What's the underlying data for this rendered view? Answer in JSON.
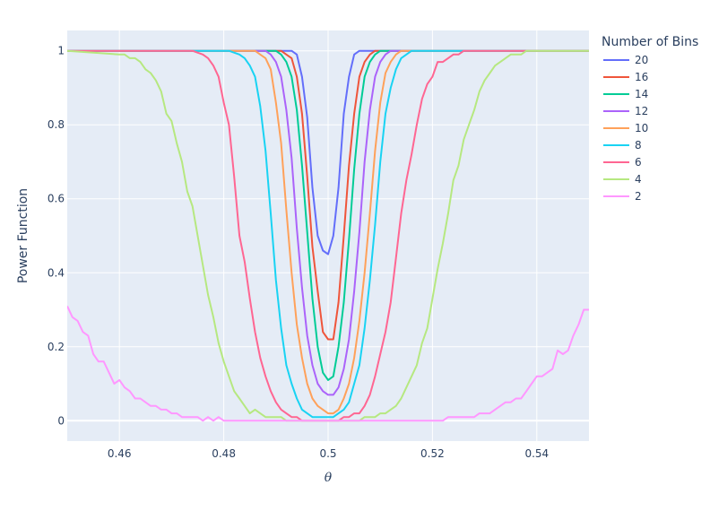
{
  "chart_data": {
    "type": "line",
    "xlabel": "θ",
    "ylabel": "Power Function",
    "xlim": [
      0.45,
      0.55
    ],
    "ylim": [
      -0.055,
      1.055
    ],
    "x_ticks": [
      0.46,
      0.48,
      0.5,
      0.52,
      0.54
    ],
    "x_tick_labels": [
      "0.46",
      "0.48",
      "0.5",
      "0.52",
      "0.54"
    ],
    "y_ticks": [
      0,
      0.2,
      0.4,
      0.6,
      0.8,
      1
    ],
    "y_tick_labels": [
      "0",
      "0.2",
      "0.4",
      "0.6",
      "0.8",
      "1"
    ],
    "grid": true,
    "legend_title": "Number of Bins",
    "legend_position": "right",
    "series": [
      {
        "name": "20",
        "color": "#636efa",
        "x": [
          0.45,
          0.49,
          0.493,
          0.494,
          0.495,
          0.496,
          0.497,
          0.498,
          0.499,
          0.5,
          0.501,
          0.502,
          0.503,
          0.504,
          0.505,
          0.506,
          0.507,
          0.55
        ],
        "y": [
          1,
          1,
          1,
          0.99,
          0.93,
          0.82,
          0.63,
          0.5,
          0.46,
          0.45,
          0.5,
          0.63,
          0.83,
          0.93,
          0.99,
          1,
          1,
          1
        ]
      },
      {
        "name": "16",
        "color": "#EF553B",
        "x": [
          0.45,
          0.489,
          0.491,
          0.492,
          0.493,
          0.494,
          0.495,
          0.496,
          0.497,
          0.498,
          0.499,
          0.5,
          0.501,
          0.502,
          0.503,
          0.504,
          0.505,
          0.506,
          0.507,
          0.508,
          0.509,
          0.511,
          0.55
        ],
        "y": [
          1,
          1,
          1,
          0.99,
          0.98,
          0.93,
          0.83,
          0.66,
          0.47,
          0.35,
          0.24,
          0.22,
          0.22,
          0.32,
          0.5,
          0.69,
          0.83,
          0.93,
          0.97,
          0.99,
          1,
          1,
          1
        ]
      },
      {
        "name": "14",
        "color": "#00cc96",
        "x": [
          0.45,
          0.488,
          0.49,
          0.491,
          0.492,
          0.493,
          0.494,
          0.495,
          0.496,
          0.497,
          0.498,
          0.499,
          0.5,
          0.501,
          0.502,
          0.503,
          0.504,
          0.505,
          0.506,
          0.507,
          0.508,
          0.509,
          0.51,
          0.512,
          0.55
        ],
        "y": [
          1,
          1,
          1,
          0.99,
          0.97,
          0.93,
          0.84,
          0.69,
          0.51,
          0.33,
          0.2,
          0.13,
          0.11,
          0.12,
          0.2,
          0.32,
          0.49,
          0.68,
          0.83,
          0.93,
          0.97,
          0.99,
          1,
          1,
          1
        ]
      },
      {
        "name": "12",
        "color": "#ab63fa",
        "x": [
          0.45,
          0.486,
          0.488,
          0.489,
          0.49,
          0.491,
          0.492,
          0.493,
          0.494,
          0.495,
          0.496,
          0.497,
          0.498,
          0.499,
          0.5,
          0.501,
          0.502,
          0.503,
          0.504,
          0.505,
          0.506,
          0.507,
          0.508,
          0.509,
          0.51,
          0.511,
          0.512,
          0.514,
          0.55
        ],
        "y": [
          1,
          1,
          1,
          0.99,
          0.97,
          0.93,
          0.84,
          0.71,
          0.52,
          0.36,
          0.23,
          0.15,
          0.1,
          0.08,
          0.07,
          0.07,
          0.09,
          0.14,
          0.22,
          0.35,
          0.51,
          0.7,
          0.84,
          0.93,
          0.97,
          0.99,
          1,
          1,
          1
        ]
      },
      {
        "name": "10",
        "color": "#FFA15A",
        "x": [
          0.45,
          0.484,
          0.486,
          0.487,
          0.488,
          0.489,
          0.49,
          0.491,
          0.492,
          0.493,
          0.494,
          0.495,
          0.496,
          0.497,
          0.498,
          0.499,
          0.5,
          0.501,
          0.502,
          0.503,
          0.504,
          0.505,
          0.506,
          0.507,
          0.508,
          0.509,
          0.51,
          0.511,
          0.512,
          0.513,
          0.514,
          0.515,
          0.516,
          0.518,
          0.55
        ],
        "y": [
          1,
          1,
          1,
          0.99,
          0.98,
          0.95,
          0.86,
          0.75,
          0.57,
          0.4,
          0.26,
          0.17,
          0.1,
          0.06,
          0.04,
          0.03,
          0.02,
          0.02,
          0.03,
          0.06,
          0.1,
          0.17,
          0.27,
          0.4,
          0.56,
          0.73,
          0.86,
          0.94,
          0.97,
          0.99,
          1,
          1,
          1,
          1,
          1
        ]
      },
      {
        "name": "8",
        "color": "#19d3f3",
        "x": [
          0.45,
          0.481,
          0.483,
          0.484,
          0.485,
          0.486,
          0.487,
          0.488,
          0.489,
          0.49,
          0.491,
          0.492,
          0.493,
          0.494,
          0.495,
          0.496,
          0.497,
          0.498,
          0.499,
          0.5,
          0.501,
          0.502,
          0.503,
          0.504,
          0.505,
          0.506,
          0.507,
          0.508,
          0.509,
          0.51,
          0.511,
          0.512,
          0.513,
          0.514,
          0.515,
          0.516,
          0.517,
          0.518,
          0.52,
          0.55
        ],
        "y": [
          1,
          1,
          0.99,
          0.98,
          0.96,
          0.93,
          0.85,
          0.73,
          0.56,
          0.38,
          0.25,
          0.15,
          0.1,
          0.06,
          0.03,
          0.02,
          0.01,
          0.01,
          0.01,
          0.01,
          0.01,
          0.02,
          0.03,
          0.05,
          0.1,
          0.15,
          0.25,
          0.38,
          0.53,
          0.7,
          0.83,
          0.9,
          0.95,
          0.98,
          0.99,
          1,
          1,
          1,
          1,
          1
        ]
      },
      {
        "name": "6",
        "color": "#FF6692",
        "x": [
          0.45,
          0.474,
          0.476,
          0.477,
          0.478,
          0.479,
          0.48,
          0.481,
          0.482,
          0.483,
          0.484,
          0.485,
          0.486,
          0.487,
          0.488,
          0.489,
          0.49,
          0.491,
          0.492,
          0.493,
          0.494,
          0.495,
          0.496,
          0.497,
          0.498,
          0.5,
          0.502,
          0.503,
          0.504,
          0.505,
          0.506,
          0.507,
          0.508,
          0.509,
          0.51,
          0.511,
          0.512,
          0.513,
          0.514,
          0.515,
          0.516,
          0.517,
          0.518,
          0.519,
          0.52,
          0.521,
          0.522,
          0.523,
          0.524,
          0.525,
          0.526,
          0.527,
          0.528,
          0.55
        ],
        "y": [
          1,
          1,
          0.99,
          0.98,
          0.96,
          0.93,
          0.86,
          0.8,
          0.66,
          0.5,
          0.43,
          0.33,
          0.24,
          0.17,
          0.12,
          0.08,
          0.05,
          0.03,
          0.02,
          0.01,
          0.01,
          0.0,
          0.0,
          0.0,
          0.0,
          0.0,
          0.0,
          0.01,
          0.01,
          0.02,
          0.02,
          0.04,
          0.07,
          0.12,
          0.18,
          0.24,
          0.32,
          0.44,
          0.56,
          0.65,
          0.72,
          0.8,
          0.87,
          0.91,
          0.93,
          0.97,
          0.97,
          0.98,
          0.99,
          0.99,
          1,
          1,
          1,
          1
        ]
      },
      {
        "name": "4",
        "color": "#B6E880",
        "x": [
          0.45,
          0.46,
          0.461,
          0.462,
          0.463,
          0.464,
          0.465,
          0.466,
          0.467,
          0.468,
          0.469,
          0.47,
          0.471,
          0.472,
          0.473,
          0.474,
          0.475,
          0.476,
          0.477,
          0.478,
          0.479,
          0.48,
          0.481,
          0.482,
          0.483,
          0.484,
          0.485,
          0.486,
          0.487,
          0.488,
          0.489,
          0.49,
          0.491,
          0.492,
          0.493,
          0.494,
          0.495,
          0.5,
          0.505,
          0.506,
          0.507,
          0.508,
          0.509,
          0.51,
          0.511,
          0.512,
          0.513,
          0.514,
          0.515,
          0.516,
          0.517,
          0.518,
          0.519,
          0.52,
          0.521,
          0.522,
          0.523,
          0.524,
          0.525,
          0.526,
          0.527,
          0.528,
          0.529,
          0.53,
          0.531,
          0.532,
          0.533,
          0.534,
          0.535,
          0.536,
          0.537,
          0.538,
          0.539,
          0.54,
          0.541,
          0.55
        ],
        "y": [
          1,
          0.99,
          0.99,
          0.98,
          0.98,
          0.97,
          0.95,
          0.94,
          0.92,
          0.89,
          0.83,
          0.81,
          0.75,
          0.7,
          0.62,
          0.58,
          0.5,
          0.42,
          0.34,
          0.28,
          0.21,
          0.16,
          0.12,
          0.08,
          0.06,
          0.04,
          0.02,
          0.03,
          0.02,
          0.01,
          0.01,
          0.01,
          0.01,
          0.0,
          0.0,
          0.0,
          0.0,
          0.0,
          0.0,
          0.0,
          0.01,
          0.01,
          0.01,
          0.02,
          0.02,
          0.03,
          0.04,
          0.06,
          0.09,
          0.12,
          0.15,
          0.21,
          0.25,
          0.33,
          0.41,
          0.48,
          0.56,
          0.65,
          0.69,
          0.76,
          0.8,
          0.84,
          0.89,
          0.92,
          0.94,
          0.96,
          0.97,
          0.98,
          0.99,
          0.99,
          0.99,
          1,
          1,
          1,
          1,
          1
        ]
      },
      {
        "name": "2",
        "color": "#FF97FF",
        "x": [
          0.45,
          0.451,
          0.452,
          0.453,
          0.454,
          0.455,
          0.456,
          0.457,
          0.458,
          0.459,
          0.46,
          0.461,
          0.462,
          0.463,
          0.464,
          0.465,
          0.466,
          0.467,
          0.468,
          0.469,
          0.47,
          0.471,
          0.472,
          0.473,
          0.474,
          0.475,
          0.476,
          0.477,
          0.478,
          0.479,
          0.48,
          0.482,
          0.484,
          0.486,
          0.49,
          0.5,
          0.51,
          0.514,
          0.516,
          0.518,
          0.52,
          0.521,
          0.522,
          0.523,
          0.524,
          0.525,
          0.526,
          0.527,
          0.528,
          0.529,
          0.53,
          0.531,
          0.532,
          0.533,
          0.534,
          0.535,
          0.536,
          0.537,
          0.538,
          0.539,
          0.54,
          0.541,
          0.542,
          0.543,
          0.544,
          0.545,
          0.546,
          0.547,
          0.548,
          0.549,
          0.55
        ],
        "y": [
          0.31,
          0.28,
          0.27,
          0.24,
          0.23,
          0.18,
          0.16,
          0.16,
          0.13,
          0.1,
          0.11,
          0.09,
          0.08,
          0.06,
          0.06,
          0.05,
          0.04,
          0.04,
          0.03,
          0.03,
          0.02,
          0.02,
          0.01,
          0.01,
          0.01,
          0.01,
          0.0,
          0.01,
          0.0,
          0.01,
          0.0,
          0.0,
          0.0,
          0.0,
          0.0,
          0.0,
          0.0,
          0.0,
          0.0,
          0.0,
          0.0,
          0.0,
          0.0,
          0.01,
          0.01,
          0.01,
          0.01,
          0.01,
          0.01,
          0.02,
          0.02,
          0.02,
          0.03,
          0.04,
          0.05,
          0.05,
          0.06,
          0.06,
          0.08,
          0.1,
          0.12,
          0.12,
          0.13,
          0.14,
          0.19,
          0.18,
          0.19,
          0.23,
          0.26,
          0.3,
          0.3
        ]
      }
    ]
  }
}
